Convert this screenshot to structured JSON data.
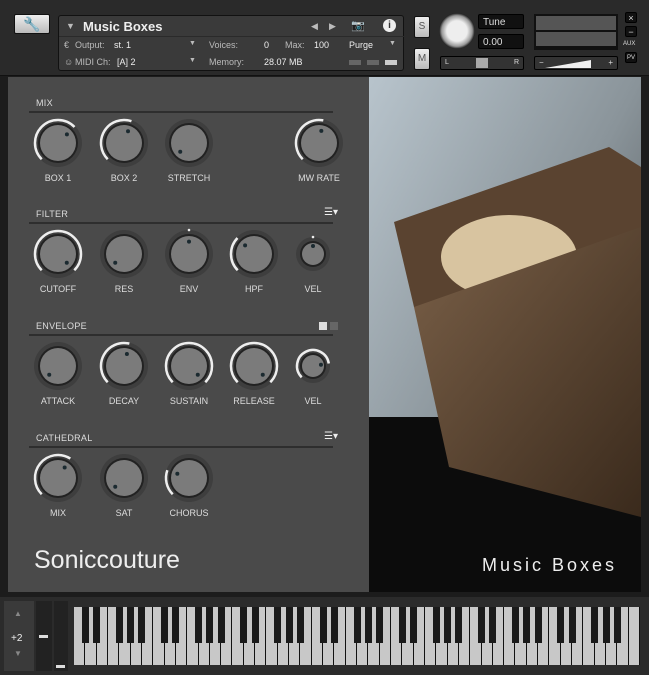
{
  "header": {
    "instrument_name": "Music Boxes",
    "output_label": "Output:",
    "output_value": "st. 1",
    "midi_label": "MIDI Ch:",
    "midi_value": "[A]  2",
    "voices_label": "Voices:",
    "voices_value": "0",
    "max_label": "Max:",
    "max_value": "100",
    "memory_label": "Memory:",
    "memory_value": "28.07 MB",
    "purge_label": "Purge",
    "solo_label": "S",
    "mute_label": "M",
    "tune_label": "Tune",
    "tune_value": "0.00",
    "pan_left": "L",
    "pan_right": "R",
    "vol_minus": "−",
    "vol_plus": "+",
    "close": "×",
    "minimize": "−",
    "aux": "AUX",
    "pv": "PV",
    "info": "i"
  },
  "sections": [
    {
      "title": "MIX",
      "knobs": [
        {
          "label": "BOX 1",
          "value": 0.67
        },
        {
          "label": "BOX 2",
          "value": 0.57
        },
        {
          "label": "STRETCH",
          "value": 0.0
        },
        {
          "label": "MW RATE",
          "value": 0.54
        }
      ]
    },
    {
      "title": "FILTER",
      "menu": true,
      "knobs": [
        {
          "label": "CUTOFF",
          "value": 1.0
        },
        {
          "label": "RES",
          "value": 0.0
        },
        {
          "label": "ENV",
          "value": 0.5,
          "bipolar": true
        },
        {
          "label": "HPF",
          "value": 0.33
        },
        {
          "label": "VEL",
          "value": 0.5,
          "bipolar": true,
          "small": true
        }
      ]
    },
    {
      "title": "ENVELOPE",
      "toggle": true,
      "knobs": [
        {
          "label": "ATTACK",
          "value": 0.0
        },
        {
          "label": "DECAY",
          "value": 0.55
        },
        {
          "label": "SUSTAIN",
          "value": 1.0
        },
        {
          "label": "RELEASE",
          "value": 1.0
        },
        {
          "label": "VEL",
          "value": 0.8,
          "small": true
        }
      ]
    },
    {
      "title": "CATHEDRAL",
      "menu": true,
      "knobs": [
        {
          "label": "MIX",
          "value": 0.62
        },
        {
          "label": "SAT",
          "value": 0.0
        },
        {
          "label": "CHORUS",
          "value": 0.24
        }
      ]
    }
  ],
  "brand": "Soniccouture",
  "image_title": "Music Boxes",
  "keyboard": {
    "octave": "+2",
    "white_keys": 50
  }
}
